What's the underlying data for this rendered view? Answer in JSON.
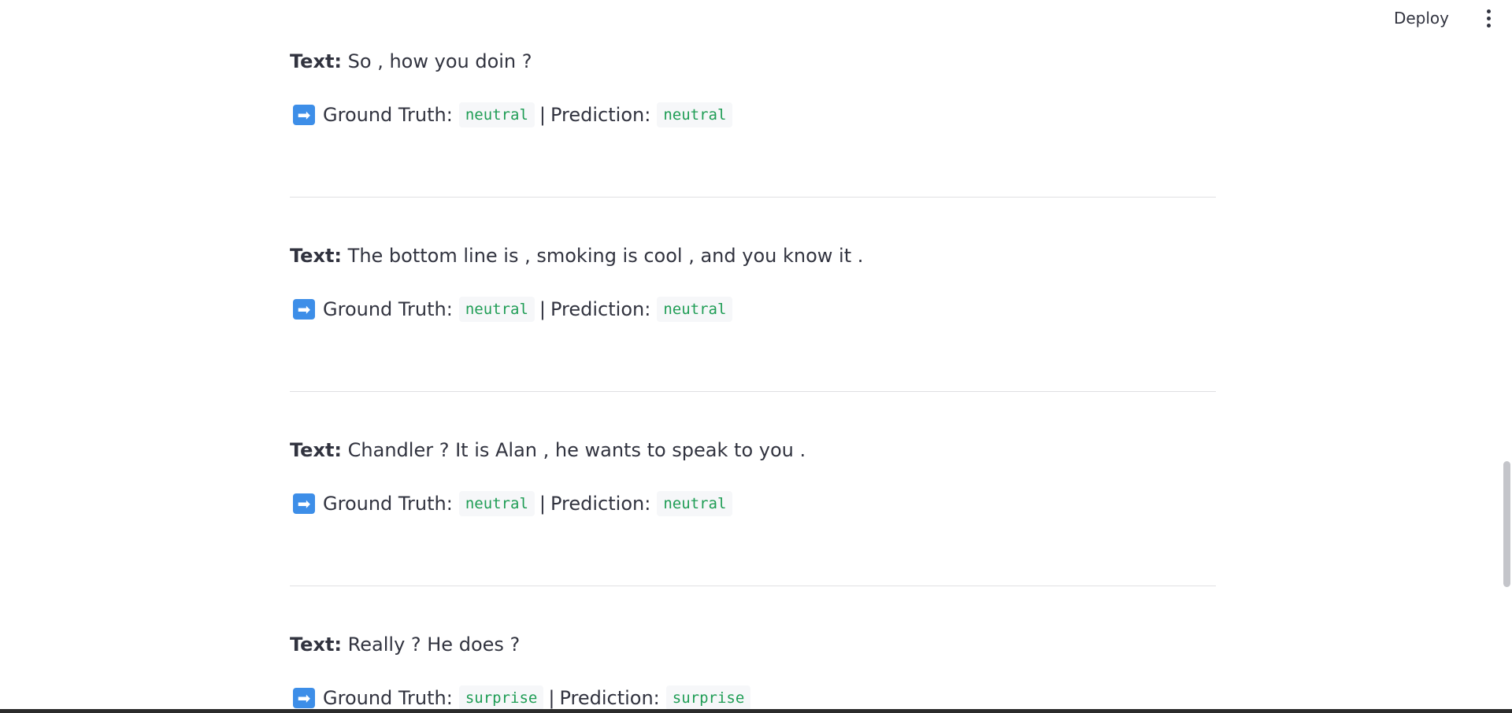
{
  "header": {
    "deploy_label": "Deploy",
    "menu_icon": "vertical-ellipsis-icon"
  },
  "entries": [
    {
      "text_label": "Text:",
      "text": "So , how you doin ?",
      "arrow_icon": "right-arrow-icon",
      "ground_truth_label": "Ground Truth:",
      "ground_truth": "neutral",
      "separator": "|",
      "prediction_label": "Prediction:",
      "prediction": "neutral"
    },
    {
      "text_label": "Text:",
      "text": "The bottom line is , smoking is cool , and you know it .",
      "arrow_icon": "right-arrow-icon",
      "ground_truth_label": "Ground Truth:",
      "ground_truth": "neutral",
      "separator": "|",
      "prediction_label": "Prediction:",
      "prediction": "neutral"
    },
    {
      "text_label": "Text:",
      "text": "Chandler ? It is Alan , he wants to speak to you .",
      "arrow_icon": "right-arrow-icon",
      "ground_truth_label": "Ground Truth:",
      "ground_truth": "neutral",
      "separator": "|",
      "prediction_label": "Prediction:",
      "prediction": "neutral"
    },
    {
      "text_label": "Text:",
      "text": "Really ? He does ?",
      "arrow_icon": "right-arrow-icon",
      "ground_truth_label": "Ground Truth:",
      "ground_truth": "surprise",
      "separator": "|",
      "prediction_label": "Prediction:",
      "prediction": "surprise"
    }
  ],
  "colors": {
    "label_code": "#1f9d55",
    "code_background": "#f6f7f9",
    "arrow_icon_background": "#3d8ee8",
    "text": "#31333f",
    "divider": "#e0e0e3"
  }
}
